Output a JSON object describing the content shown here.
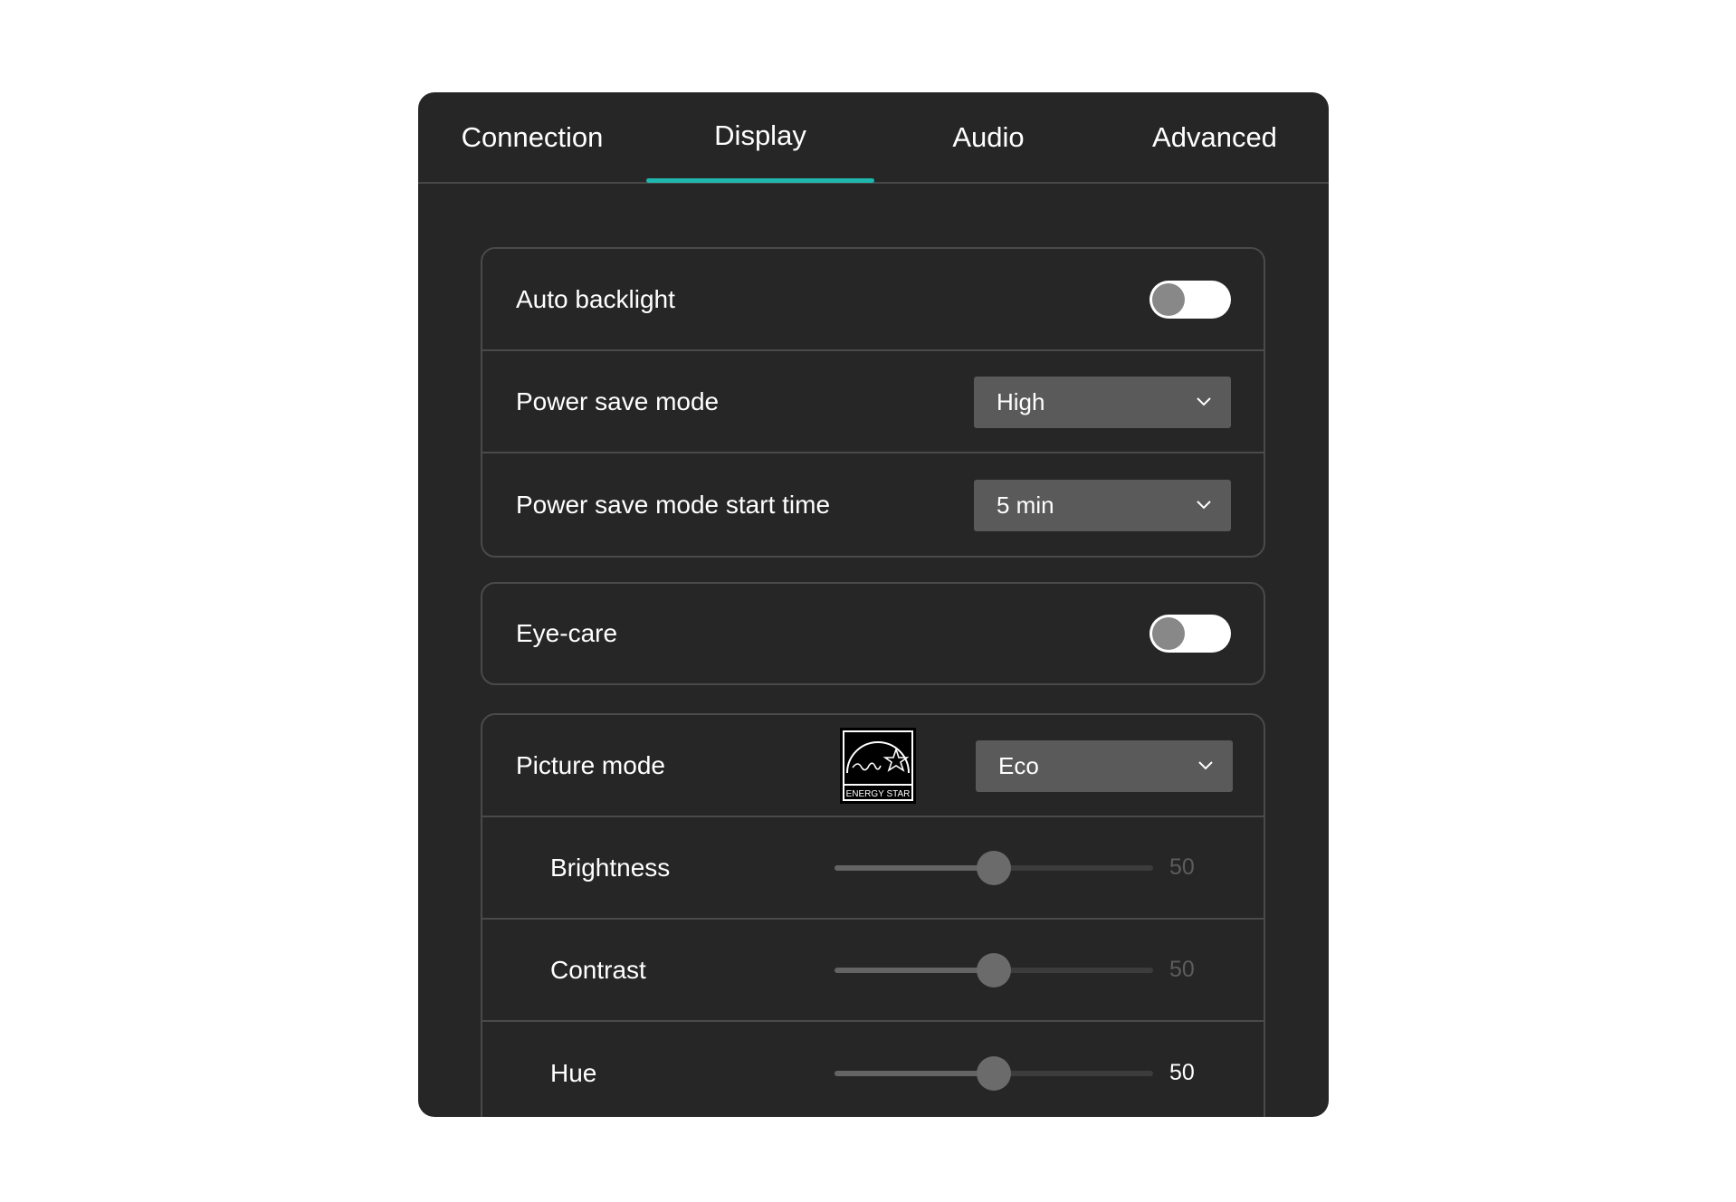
{
  "tabs": [
    {
      "label": "Connection",
      "active": false
    },
    {
      "label": "Display",
      "active": true
    },
    {
      "label": "Audio",
      "active": false
    },
    {
      "label": "Advanced",
      "active": false
    }
  ],
  "colors": {
    "accent": "#1fb6ad",
    "panel_bg": "#262626",
    "select_bg": "#5a5a5a",
    "toggle_track": "#ffffff",
    "toggle_knob": "#888888"
  },
  "power_card": {
    "auto_backlight": {
      "label": "Auto backlight",
      "enabled": false
    },
    "power_save_mode": {
      "label": "Power save mode",
      "value": "High",
      "icon": "chevron-down-icon"
    },
    "power_save_start": {
      "label": "Power save mode start time",
      "value": "5 min",
      "icon": "chevron-down-icon"
    }
  },
  "eye_card": {
    "eye_care": {
      "label": "Eye-care",
      "enabled": false
    }
  },
  "picture_card": {
    "picture_mode": {
      "label": "Picture mode",
      "value": "Eco",
      "badge_icon": "energy-star-icon",
      "badge_text": "ENERGY STAR"
    },
    "brightness": {
      "label": "Brightness",
      "value": 50,
      "value_text": "50",
      "min": 0,
      "max": 100,
      "enabled": false
    },
    "contrast": {
      "label": "Contrast",
      "value": 50,
      "value_text": "50",
      "min": 0,
      "max": 100,
      "enabled": false
    },
    "hue": {
      "label": "Hue",
      "value": 50,
      "value_text": "50",
      "min": 0,
      "max": 100,
      "enabled": true
    }
  }
}
